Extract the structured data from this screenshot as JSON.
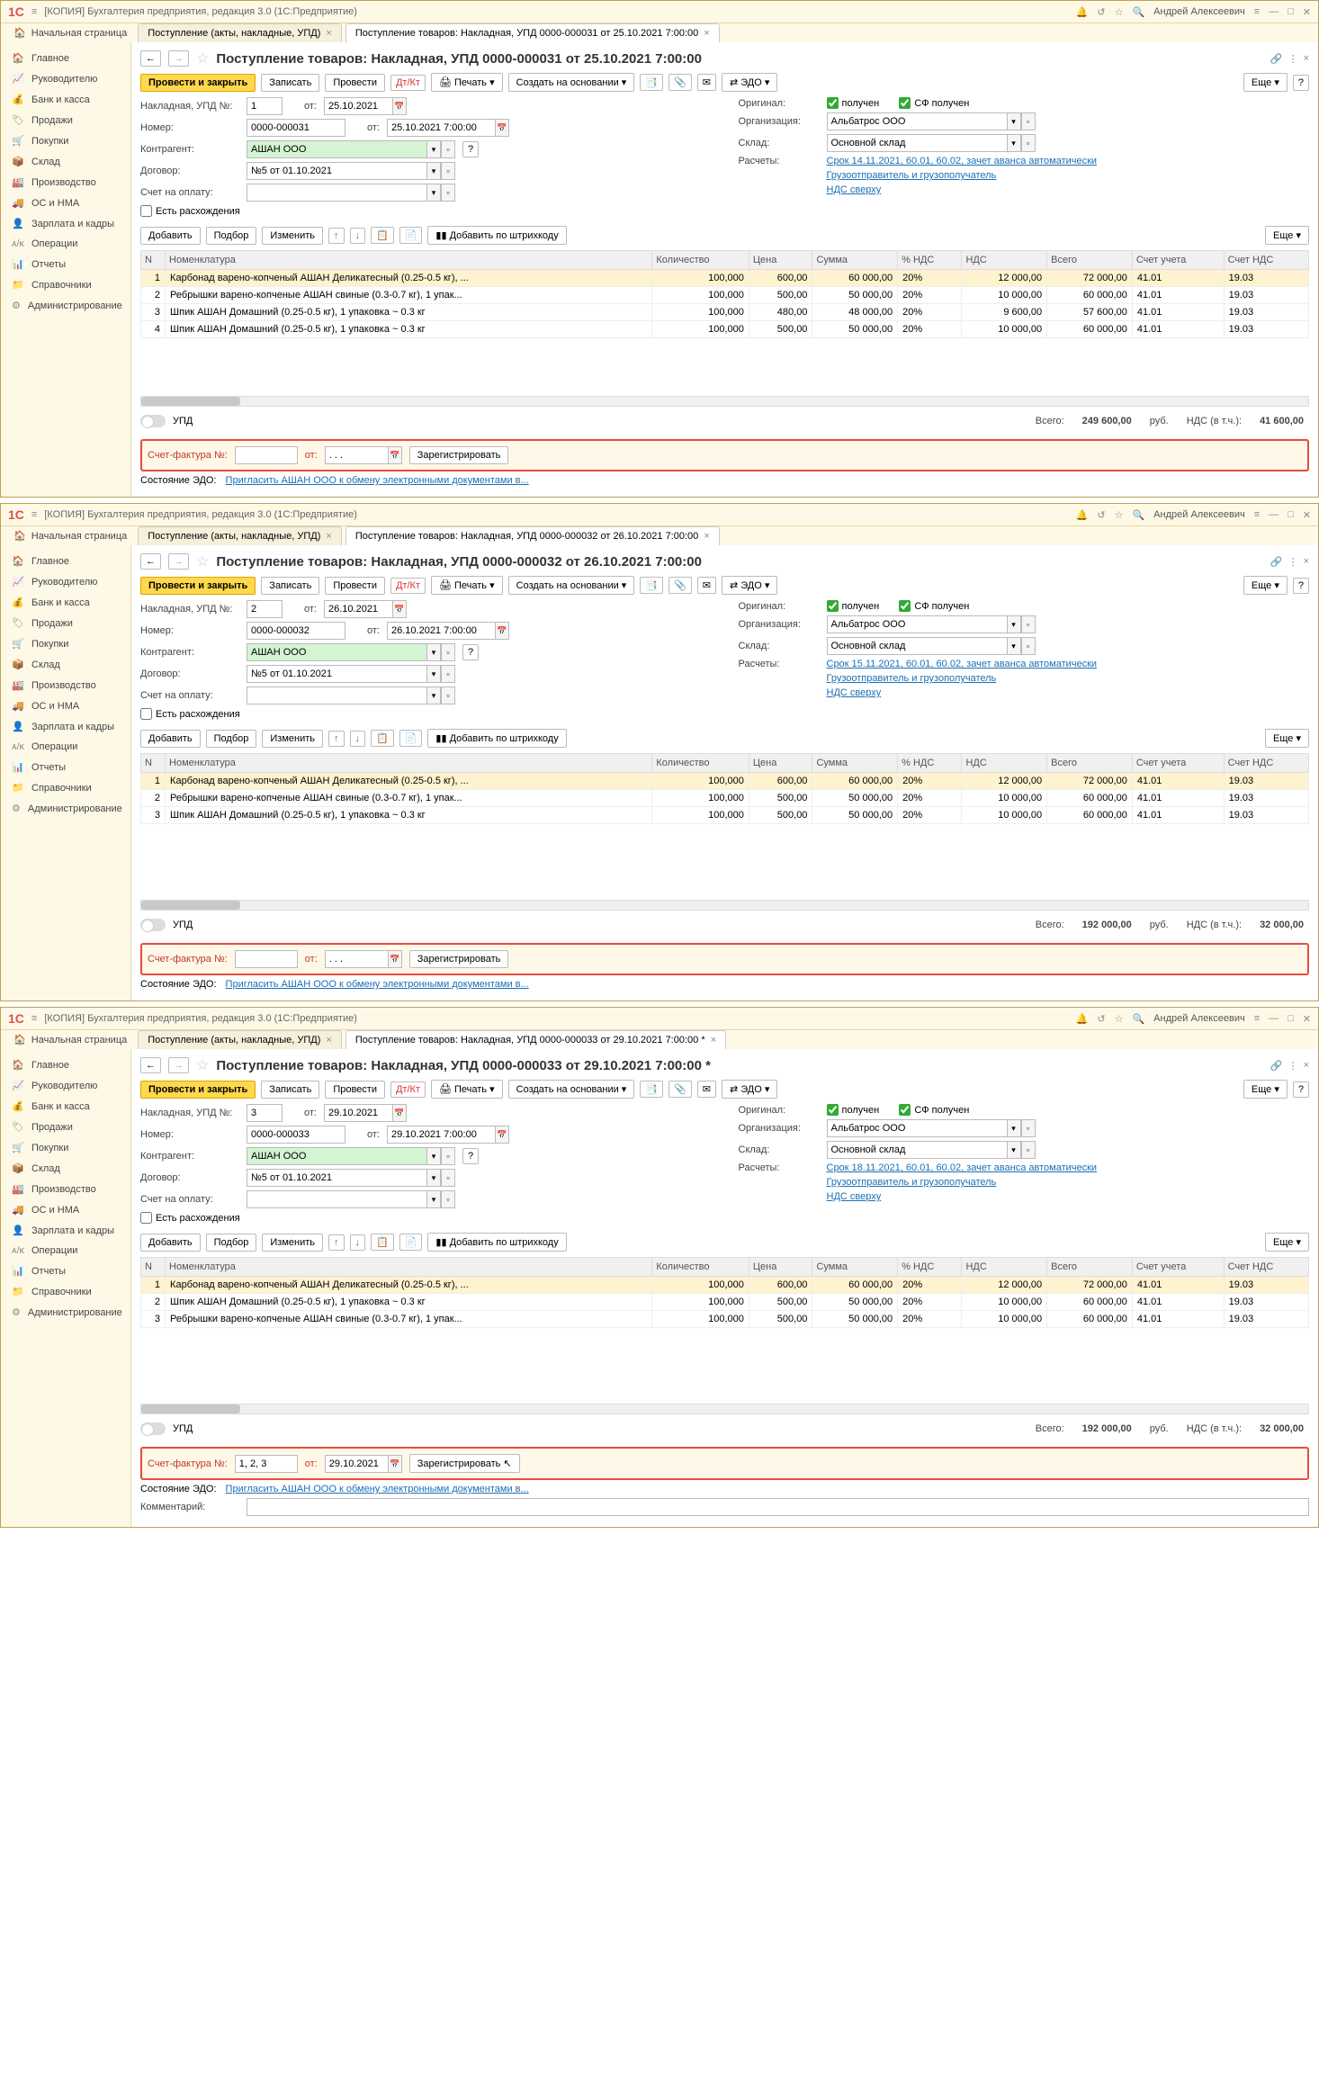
{
  "windows": [
    {
      "n": "0000-000031",
      "dt": "25.10.2021",
      "mod": "",
      "idx": 0,
      "rows": [
        {
          "i": 1,
          "nm": "Карбонад варено-копченый АШАН Деликатесный (0.25-0.5 кг), ...",
          "q": "100,000",
          "p": "600,00",
          "s": "60 000,00",
          "v": "20%",
          "nds": "12 000,00",
          "tot": "72 000,00",
          "a1": "41.01",
          "a2": "19.03"
        },
        {
          "i": 2,
          "nm": "Ребрышки варено-копченые АШАН свиные (0.3-0.7 кг), 1 упак...",
          "q": "100,000",
          "p": "500,00",
          "s": "50 000,00",
          "v": "20%",
          "nds": "10 000,00",
          "tot": "60 000,00",
          "a1": "41.01",
          "a2": "19.03"
        },
        {
          "i": 3,
          "nm": "Шпик АШАН Домашний (0.25-0.5 кг), 1 упаковка ~ 0.3 кг",
          "q": "100,000",
          "p": "480,00",
          "s": "48 000,00",
          "v": "20%",
          "nds": "9 600,00",
          "tot": "57 600,00",
          "a1": "41.01",
          "a2": "19.03"
        },
        {
          "i": 4,
          "nm": "Шпик АШАН Домашний (0.25-0.5 кг), 1 упаковка ~ 0.3 кг",
          "q": "100,000",
          "p": "500,00",
          "s": "50 000,00",
          "v": "20%",
          "nds": "10 000,00",
          "tot": "60 000,00",
          "a1": "41.01",
          "a2": "19.03"
        }
      ],
      "tot": "249 600,00",
      "vat": "41 600,00",
      "set": "Срок 14.11.2021, 60.01, 60.02, зачет аванса автоматически",
      "invN": "",
      "invD": ". . .",
      "upd": "1",
      "comment": false
    },
    {
      "n": "0000-000032",
      "dt": "26.10.2021",
      "mod": "",
      "idx": 1,
      "rows": [
        {
          "i": 1,
          "nm": "Карбонад варено-копченый АШАН Деликатесный (0.25-0.5 кг), ...",
          "q": "100,000",
          "p": "600,00",
          "s": "60 000,00",
          "v": "20%",
          "nds": "12 000,00",
          "tot": "72 000,00",
          "a1": "41.01",
          "a2": "19.03"
        },
        {
          "i": 2,
          "nm": "Ребрышки варено-копченые АШАН свиные (0.3-0.7 кг), 1 упак...",
          "q": "100,000",
          "p": "500,00",
          "s": "50 000,00",
          "v": "20%",
          "nds": "10 000,00",
          "tot": "60 000,00",
          "a1": "41.01",
          "a2": "19.03"
        },
        {
          "i": 3,
          "nm": "Шпик АШАН Домашний (0.25-0.5 кг), 1 упаковка ~ 0.3 кг",
          "q": "100,000",
          "p": "500,00",
          "s": "50 000,00",
          "v": "20%",
          "nds": "10 000,00",
          "tot": "60 000,00",
          "a1": "41.01",
          "a2": "19.03"
        }
      ],
      "tot": "192 000,00",
      "vat": "32 000,00",
      "set": "Срок 15.11.2021, 60.01, 60.02, зачет аванса автоматически",
      "invN": "",
      "invD": ". . .",
      "upd": "2",
      "comment": false
    },
    {
      "n": "0000-000033",
      "dt": "29.10.2021",
      "mod": " *",
      "idx": 2,
      "rows": [
        {
          "i": 1,
          "nm": "Карбонад варено-копченый АШАН Деликатесный (0.25-0.5 кг), ...",
          "q": "100,000",
          "p": "600,00",
          "s": "60 000,00",
          "v": "20%",
          "nds": "12 000,00",
          "tot": "72 000,00",
          "a1": "41.01",
          "a2": "19.03"
        },
        {
          "i": 2,
          "nm": "Шпик АШАН Домашний (0.25-0.5 кг), 1 упаковка ~ 0.3 кг",
          "q": "100,000",
          "p": "500,00",
          "s": "50 000,00",
          "v": "20%",
          "nds": "10 000,00",
          "tot": "60 000,00",
          "a1": "41.01",
          "a2": "19.03"
        },
        {
          "i": 3,
          "nm": "Ребрышки варено-копченые АШАН свиные (0.3-0.7 кг), 1 упак...",
          "q": "100,000",
          "p": "500,00",
          "s": "50 000,00",
          "v": "20%",
          "nds": "10 000,00",
          "tot": "60 000,00",
          "a1": "41.01",
          "a2": "19.03"
        }
      ],
      "tot": "192 000,00",
      "vat": "32 000,00",
      "set": "Срок 18.11.2021, 60.01, 60.02, зачет аванса автоматически",
      "invN": "1, 2, 3",
      "invD": "29.10.2021",
      "upd": "3",
      "comment": true
    }
  ],
  "app": "[КОПИЯ] Бухгалтерия предприятия, редакция 3.0  (1С:Предприятие)",
  "user": "Андрей Алексеевич",
  "home": "Начальная страница",
  "tab1": "Поступление (акты, накладные, УПД)",
  "tab2_pre": "Поступление товаров: Накладная, УПД ",
  "tab2_mid": " от ",
  "tab2_time": " 7:00:00",
  "sidebar": [
    "Главное",
    "Руководителю",
    "Банк и касса",
    "Продажи",
    "Покупки",
    "Склад",
    "Производство",
    "ОС и НМА",
    "Зарплата и кадры",
    "Операции",
    "Отчеты",
    "Справочники",
    "Администрирование"
  ],
  "side_ic": [
    "🏠",
    "📈",
    "💰",
    "🏷",
    "🛒",
    "📦",
    "🏭",
    "🚚",
    "👤",
    "ᴀ/ᴋ",
    "📊",
    "📁",
    "⚙"
  ],
  "title_pre": "Поступление товаров: Накладная, УПД ",
  "tb": {
    "post": "Провести и закрыть",
    "save": "Записать",
    "run": "Провести",
    "print": "Печать",
    "base": "Создать на основании",
    "edo": "ЭДО",
    "more": "Еще"
  },
  "fm": {
    "upd_no": "Накладная, УПД №:",
    "from": "от:",
    "num": "Номер:",
    "ctr": "Контрагент:",
    "dog": "Договор:",
    "bill": "Счет на оплату:",
    "disc": "Есть расхождения",
    "org": "Организация:",
    "store": "Склад:",
    "set": "Расчеты:",
    "orig": "Оригинал:",
    "got": "получен",
    "sf": "СФ получен",
    "shipper": "Грузоотправитель и грузополучатель",
    "nds": "НДС сверху"
  },
  "vals": {
    "ctr": "АШАН ООО",
    "dog": "№5 от 01.10.2021",
    "org": "Альбатрос ООО",
    "store": "Основной склад"
  },
  "tbl": {
    "add": "Добавить",
    "pick": "Подбор",
    "edit": "Изменить",
    "bc": "Добавить по штрихкоду",
    "more": "Еще"
  },
  "cols": [
    "N",
    "Номенклатура",
    "Количество",
    "Цена",
    "Сумма",
    "% НДС",
    "НДС",
    "Всего",
    "Счет учета",
    "Счет НДС"
  ],
  "sum": {
    "tot": "Всего:",
    "rub": "руб.",
    "vat": "НДС (в т.ч.):"
  },
  "upd_lbl": "УПД",
  "inv": {
    "lbl": "Счет-фактура №:",
    "from": "от:",
    "reg": "Зарегистрировать"
  },
  "edo": {
    "lbl": "Состояние ЭДО:",
    "link": "Пригласить АШАН ООО к обмену электронными документами в..."
  },
  "comment": "Комментарий:"
}
